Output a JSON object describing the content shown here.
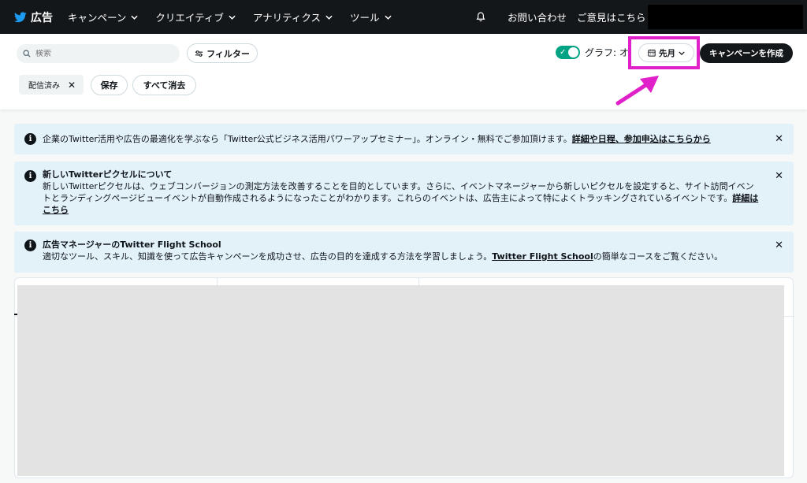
{
  "nav": {
    "brand": "広告",
    "menu": [
      {
        "label": "キャンペーン"
      },
      {
        "label": "クリエイティブ"
      },
      {
        "label": "アナリティクス"
      },
      {
        "label": "ツール"
      }
    ],
    "contact": "お問い合わせ",
    "feedback": "ご意見はこちら"
  },
  "toolbar": {
    "search_placeholder": "検索",
    "filter_label": "フィルター",
    "graph_label": "グラフ: オン",
    "graph_enabled": true,
    "date_label": "先月",
    "create_label": "キャンペーンを作成",
    "chip_label": "配信済み",
    "save_label": "保存",
    "clear_label": "すべて消去"
  },
  "notices": [
    {
      "title": "",
      "text": "企業のTwitter活用や広告の最適化を学ぶなら「Twitter公式ビジネス活用パワーアップセミナー」。オンライン・無料でご参加頂けます。",
      "link": "詳細や日程、参加申込はこちらから"
    },
    {
      "title": "新しいTwitterピクセルについて",
      "text": "新しいTwitterピクセルは、ウェブコンバージョンの測定方法を改善することを目的としています。さらに、イベントマネージャーから新しいピクセルを設定すると、サイト訪問イベントとランディングページビューイベントが自動作成されるようになったことがわかります。これらのイベントは、広告主によって特によくトラッキングされているイベントです。",
      "link": "詳細はこちら"
    },
    {
      "title": "広告マネージャーのTwitter Flight School",
      "text_before": "適切なツール、スキル、知識を使って広告キャンペーンを成功させ、広告の目的を達成する方法を学習しましょう。",
      "link": "Twitter Flight School",
      "text_after": "の簡単なコースをご覧ください。"
    }
  ],
  "colors": {
    "nav_bg": "#14171a",
    "toggle_on": "#00a383",
    "notice_bg": "#e3f2f9",
    "highlight": "#e020c8"
  }
}
